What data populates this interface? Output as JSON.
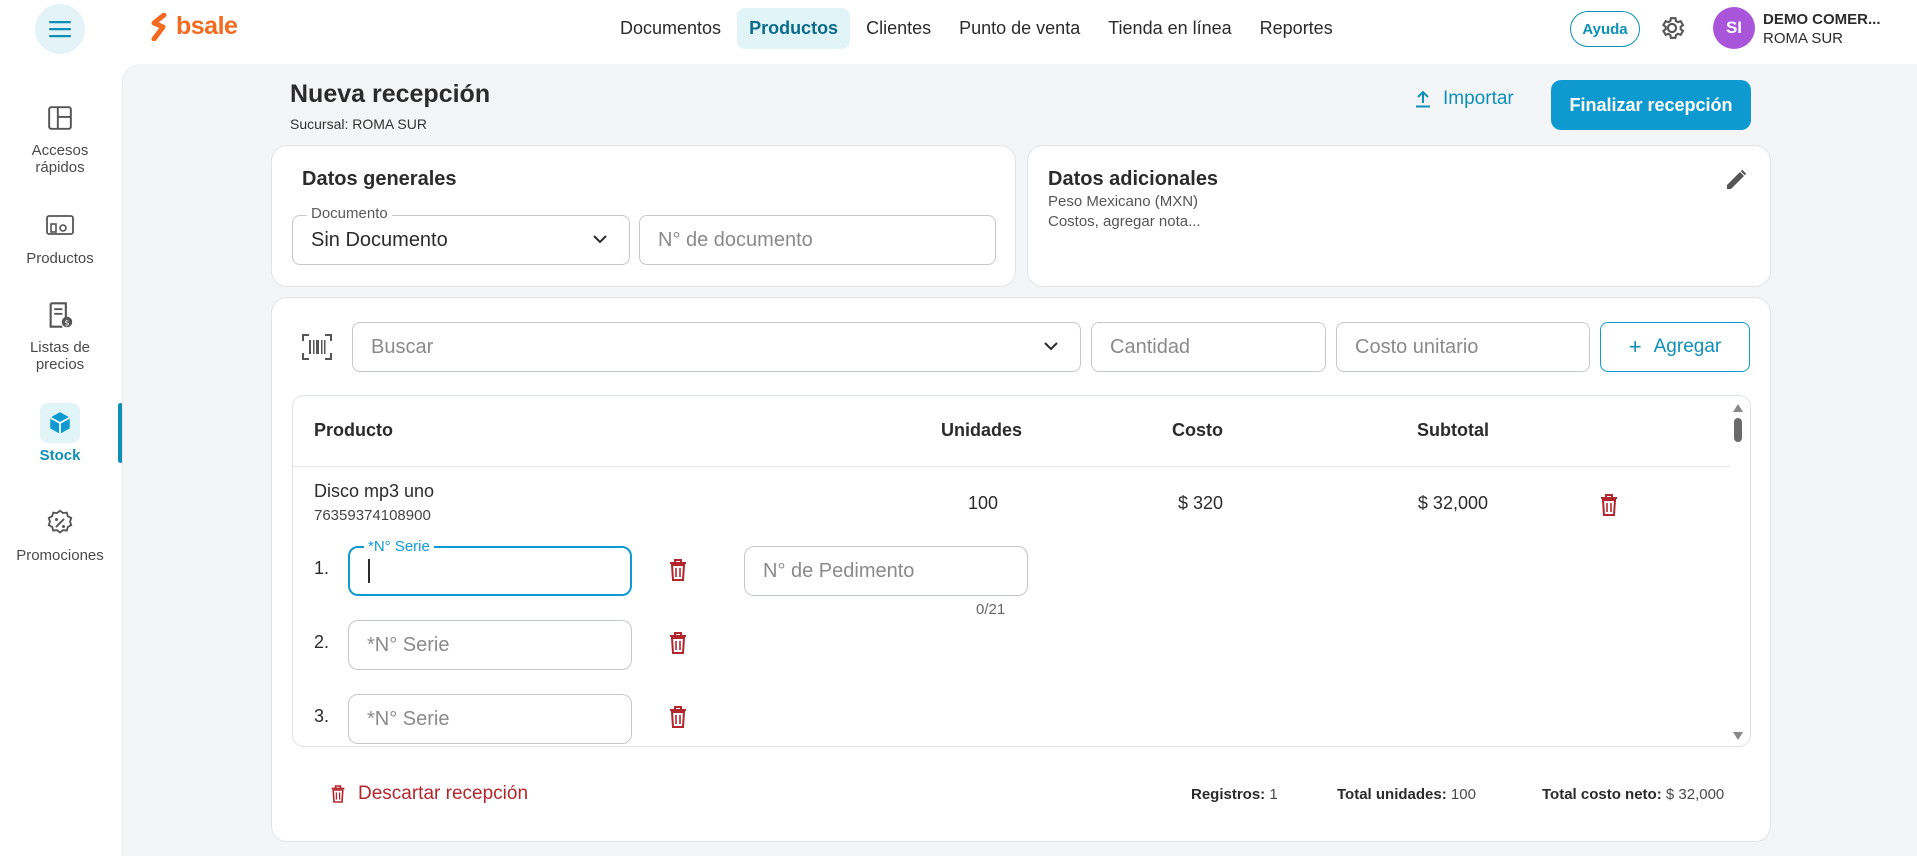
{
  "header": {
    "logo_text": "bsale",
    "nav": [
      "Documentos",
      "Productos",
      "Clientes",
      "Punto de venta",
      "Tienda en línea",
      "Reportes"
    ],
    "active_nav": "Productos",
    "help_label": "Ayuda",
    "avatar_initials": "SI",
    "account_name": "DEMO COMER...",
    "account_branch": "ROMA SUR"
  },
  "sidebar": {
    "items": [
      {
        "label": "Accesos rápidos",
        "icon": "layout-icon"
      },
      {
        "label": "Productos",
        "icon": "products-icon"
      },
      {
        "label": "Listas de precios",
        "icon": "price-list-icon"
      },
      {
        "label": "Stock",
        "icon": "box-icon",
        "active": true
      },
      {
        "label": "Promociones",
        "icon": "promo-icon"
      }
    ]
  },
  "page": {
    "title": "Nueva recepción",
    "subtitle": "Sucursal: ROMA SUR",
    "import_label": "Importar",
    "finish_label": "Finalizar recepción"
  },
  "general": {
    "title": "Datos generales",
    "document_label": "Documento",
    "document_value": "Sin Documento",
    "doc_number_placeholder": "N° de documento"
  },
  "additional": {
    "title": "Datos adicionales",
    "currency": "Peso Mexicano (MXN)",
    "note": "Costos, agregar nota..."
  },
  "entry": {
    "search_placeholder": "Buscar",
    "quantity_placeholder": "Cantidad",
    "unit_cost_placeholder": "Costo unitario",
    "add_label": "Agregar"
  },
  "table": {
    "columns": [
      "Producto",
      "Unidades",
      "Costo",
      "Subtotal"
    ],
    "rows": [
      {
        "name": "Disco mp3 uno",
        "code": "76359374108900",
        "units": "100",
        "cost": "$ 320",
        "subtotal": "$ 32,000"
      }
    ],
    "serial_label": "*N° Serie",
    "serial_numbers": [
      "1.",
      "2.",
      "3."
    ],
    "pedimento_placeholder": "N° de Pedimento",
    "pedimento_counter": "0/21"
  },
  "footer": {
    "discard_label": "Descartar recepción",
    "records_label": "Registros:",
    "records_value": "1",
    "total_units_label": "Total unidades:",
    "total_units_value": "100",
    "total_cost_label": "Total costo neto:",
    "total_cost_value": "$ 32,000"
  },
  "colors": {
    "accent": "#0e9ad0",
    "brand": "#f26b21",
    "danger": "#b3262d",
    "avatar": "#a855d9"
  }
}
